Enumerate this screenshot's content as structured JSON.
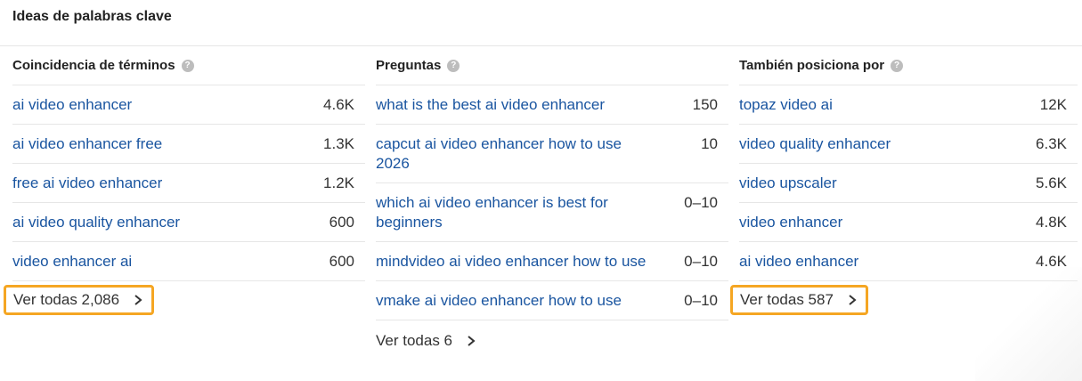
{
  "title": "Ideas de palabras clave",
  "columns": [
    {
      "header": "Coincidencia de términos",
      "rows": [
        {
          "keyword": "ai video enhancer",
          "volume": "4.6K"
        },
        {
          "keyword": "ai video enhancer free",
          "volume": "1.3K"
        },
        {
          "keyword": "free ai video enhancer",
          "volume": "1.2K"
        },
        {
          "keyword": "ai video quality enhancer",
          "volume": "600"
        },
        {
          "keyword": "video enhancer ai",
          "volume": "600"
        }
      ],
      "view_all": "Ver todas 2,086"
    },
    {
      "header": "Preguntas",
      "rows": [
        {
          "keyword": "what is the best ai video enhancer",
          "volume": "150"
        },
        {
          "keyword": "capcut ai video enhancer how to use 2026",
          "volume": "10"
        },
        {
          "keyword": "which ai video enhancer is best for beginners",
          "volume": "0–10"
        },
        {
          "keyword": "mindvideo ai video enhancer how to use",
          "volume": "0–10"
        },
        {
          "keyword": "vmake ai video enhancer how to use",
          "volume": "0–10"
        }
      ],
      "view_all": "Ver todas 6"
    },
    {
      "header": "También posiciona por",
      "rows": [
        {
          "keyword": "topaz video ai",
          "volume": "12K"
        },
        {
          "keyword": "video quality enhancer",
          "volume": "6.3K"
        },
        {
          "keyword": "video upscaler",
          "volume": "5.6K"
        },
        {
          "keyword": "video enhancer",
          "volume": "4.8K"
        },
        {
          "keyword": "ai video enhancer",
          "volume": "4.6K"
        }
      ],
      "view_all": "Ver todas 587"
    }
  ],
  "icons": {
    "help": "question-circle-icon",
    "chevron": "chevron-right-icon"
  },
  "colors": {
    "link": "#1a55a0",
    "highlight": "#f5a623"
  }
}
